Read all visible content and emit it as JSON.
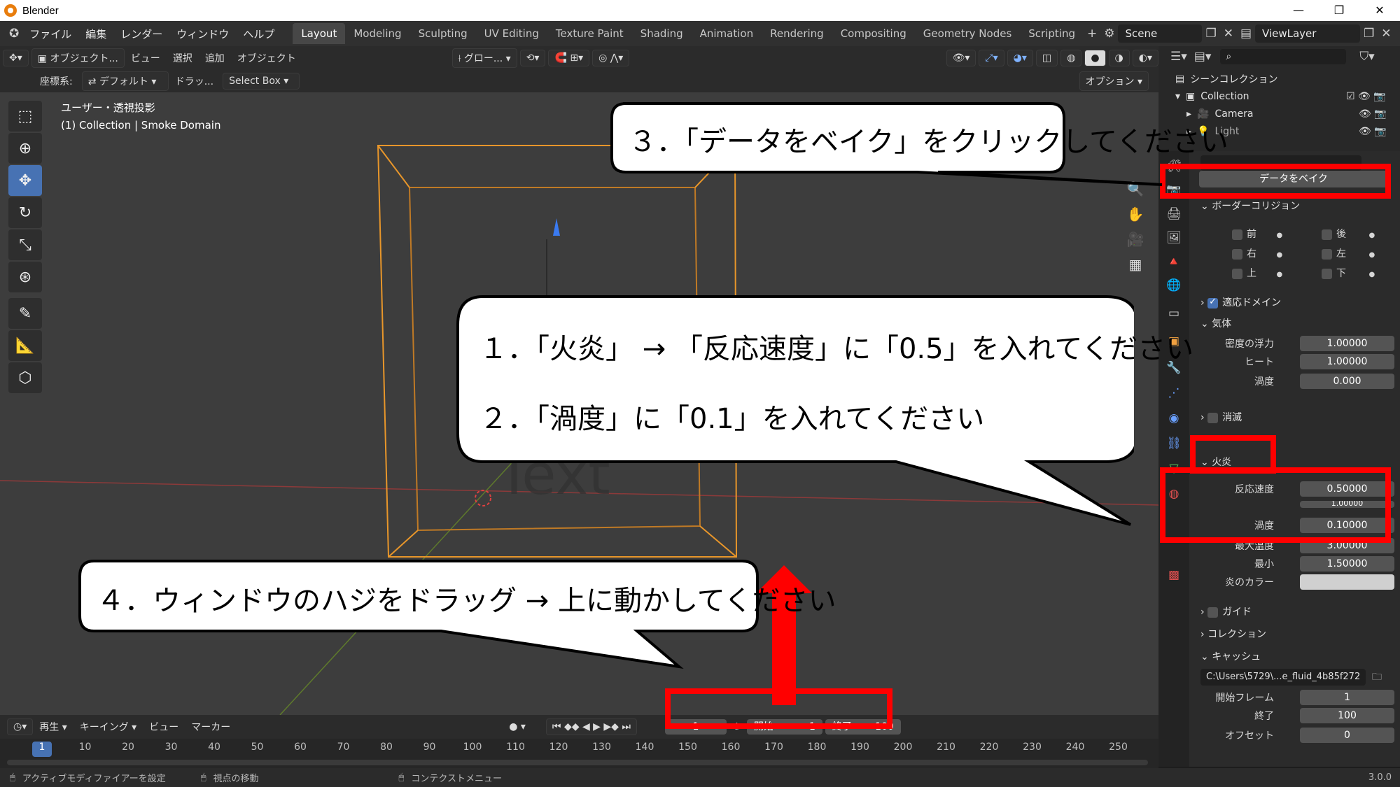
{
  "window": {
    "title": "Blender",
    "minimize": "—",
    "maximize": "❐",
    "close": "✕"
  },
  "menu": [
    "ファイル",
    "編集",
    "レンダー",
    "ウィンドウ",
    "ヘルプ"
  ],
  "workspaces": [
    "Layout",
    "Modeling",
    "Sculpting",
    "UV Editing",
    "Texture Paint",
    "Shading",
    "Animation",
    "Rendering",
    "Compositing",
    "Geometry Nodes",
    "Scripting"
  ],
  "active_workspace": "Layout",
  "add_workspace": "+",
  "scene": "Scene",
  "view_layer": "ViewLayer",
  "header": {
    "mode": "オブジェクト...",
    "view": "ビュー",
    "select": "選択",
    "add": "追加",
    "object": "オブジェクト",
    "transform_orientation": "グロー...",
    "coord_label": "座標系:",
    "coord_value": "デフォルト",
    "drag_label": "ドラッ...",
    "drag_value": "Select Box",
    "options": "オプション"
  },
  "viewport": {
    "projection": "ユーザー・透視投影",
    "collection_info": "(1) Collection | Smoke Domain",
    "text_object": "Text"
  },
  "bubbles": {
    "step3": "３．「データをベイク」をクリックしてください",
    "step1": "１．「火炎」 → 「反応速度」に「0.5」を入れてください",
    "step2": "２．「渦度」に「0.1」を入れてください",
    "step4": "４．ウィンドウのハジをドラッグ → 上に動かしてください"
  },
  "outliner": {
    "scene_collection": "シーンコレクション",
    "collection": "Collection",
    "camera": "Camera",
    "light": "Light"
  },
  "properties": {
    "bake_data": "データをベイク",
    "border_collision": "ボーダーコリジョン",
    "front": "前",
    "back": "後",
    "right": "右",
    "left": "左",
    "top": "上",
    "bottom": "下",
    "adaptive_domain": "適応ドメイン",
    "gas": "気体",
    "density_buoyancy": "密度の浮力",
    "density_buoyancy_value": "1.00000",
    "heat": "ヒート",
    "heat_value": "1.00000",
    "vorticity_gas": "渦度",
    "vorticity_gas_value": "0.000",
    "dissolve": "消滅",
    "fire": "火炎",
    "reaction_speed": "反応速度",
    "reaction_speed_value": "0.50000",
    "flame_smoke_value": "1.00000",
    "vorticity_fire": "渦度",
    "vorticity_fire_value": "0.10000",
    "max_temp": "最大温度",
    "max_temp_value": "3.00000",
    "min": "最小",
    "min_value": "1.50000",
    "flame_color": "炎のカラー",
    "guides": "ガイド",
    "collections": "コレクション",
    "cache": "キャッシュ",
    "cache_path": "C:\\Users\\5729\\...e_fluid_4b85f272",
    "frame_start": "開始フレーム",
    "frame_start_value": "1",
    "frame_end": "終了",
    "frame_end_value": "100",
    "offset": "オフセット",
    "offset_value": "0"
  },
  "timeline": {
    "playback": "再生",
    "keying": "キーイング",
    "view": "ビュー",
    "marker": "マーカー",
    "current_frame": "1",
    "start_label": "開始",
    "start": "1",
    "end_label": "終了",
    "end": "100",
    "ticks": [
      "1",
      "10",
      "20",
      "30",
      "40",
      "50",
      "60",
      "70",
      "80",
      "90",
      "100",
      "110",
      "120",
      "130",
      "140",
      "150",
      "160",
      "170",
      "180",
      "190",
      "200",
      "210",
      "220",
      "230",
      "240",
      "250"
    ]
  },
  "status": {
    "left": "アクティブモディファイアーを設定",
    "middle": "視点の移動",
    "right": "コンテクストメニュー",
    "version": "3.0.0"
  },
  "colors": {
    "highlight": "#ff0000",
    "active_tab": "#4772b3",
    "selection_orange": "#e8962a"
  }
}
